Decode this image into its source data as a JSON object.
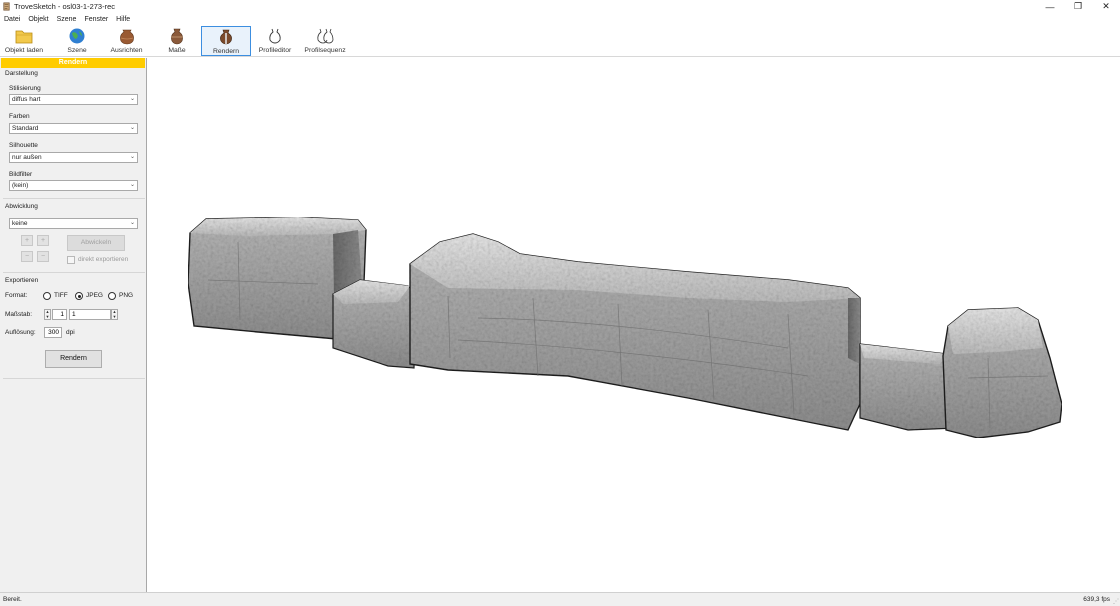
{
  "window": {
    "title": "TroveSketch - osl03-1-273-rec",
    "minimize_glyph": "—",
    "restore_glyph": "❐",
    "close_glyph": "✕"
  },
  "menu": [
    "Datei",
    "Objekt",
    "Szene",
    "Fenster",
    "Hilfe"
  ],
  "toolbar": {
    "buttons": [
      {
        "label": "Objekt laden",
        "icon": "folder-icon"
      },
      {
        "label": "Szene",
        "icon": "globe-icon"
      },
      {
        "label": "Ausrichten",
        "icon": "pot-icon"
      },
      {
        "label": "Maße",
        "icon": "vessel-icon"
      },
      {
        "label": "Rendern",
        "icon": "render-vessel-icon",
        "active": true
      },
      {
        "label": "Profileditor",
        "icon": "profile-icon"
      },
      {
        "label": "Profilsequenz",
        "icon": "profile-sequence-icon"
      }
    ]
  },
  "panel": {
    "header": "Rendern",
    "darstellung": {
      "title": "Darstellung",
      "stilisierung_label": "Stilisierung",
      "stilisierung_value": "diffus hart",
      "farben_label": "Farben",
      "farben_value": "Standard",
      "silhouette_label": "Silhouette",
      "silhouette_value": "nur außen",
      "bildfilter_label": "Bildfilter",
      "bildfilter_value": "(kein)"
    },
    "abwicklung": {
      "title": "Abwicklung",
      "value": "keine",
      "plus": "+",
      "minus": "−",
      "button": "Abwickeln",
      "checkbox_label": "direkt exportieren"
    },
    "exportieren": {
      "title": "Exportieren",
      "format_label": "Format:",
      "formats": [
        "TIFF",
        "JPEG",
        "PNG"
      ],
      "selected_format": "JPEG",
      "massstab_label": "Maßstab:",
      "massstab_left": "1",
      "massstab_right": "1",
      "aufloesung_label": "Auflösung:",
      "aufloesung_value": "300",
      "dpi_label": "dpi",
      "render_button": "Rendern"
    }
  },
  "status": {
    "left": "Bereit.",
    "right": "639,3 fps"
  },
  "colors": {
    "panel_header": "#ffcc00",
    "active_button_border": "#3c8ee0",
    "model_gray": "#a9a9a9"
  }
}
